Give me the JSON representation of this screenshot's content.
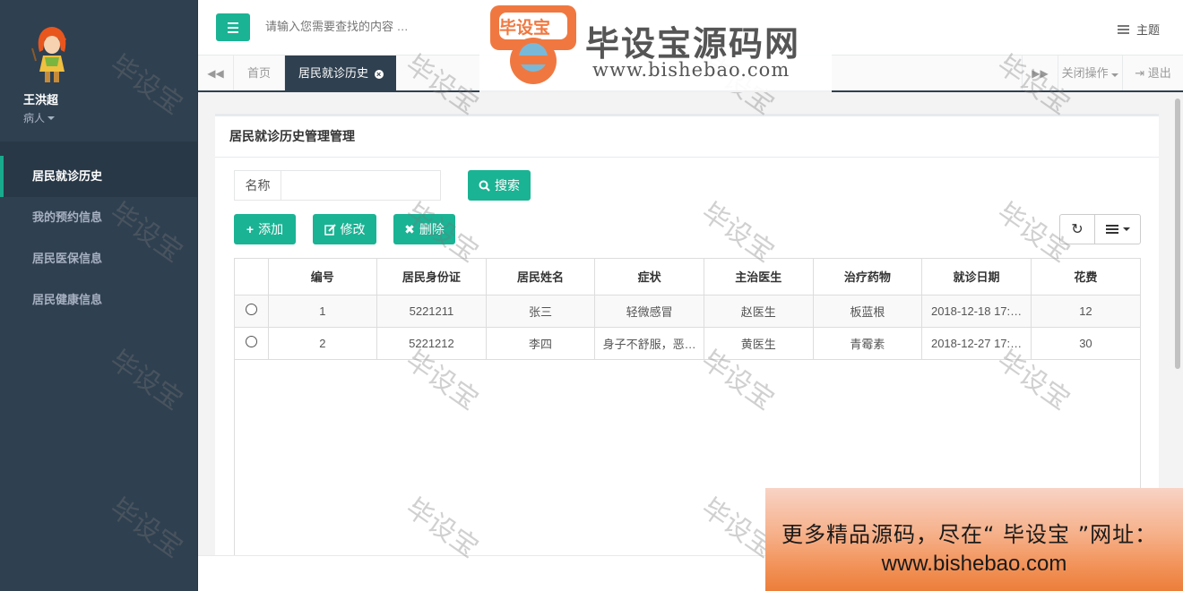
{
  "sidebar": {
    "user_name": "王洪超",
    "user_role": "病人",
    "items": [
      {
        "label": "居民就诊历史"
      },
      {
        "label": "我的预约信息"
      },
      {
        "label": "居民医保信息"
      },
      {
        "label": "居民健康信息"
      }
    ]
  },
  "topbar": {
    "search_placeholder": "请输入您需要查找的内容 …",
    "theme_label": "主题"
  },
  "tabs": {
    "home": "首页",
    "active": "居民就诊历史",
    "close_ops": "关闭操作",
    "logout": "退出"
  },
  "panel": {
    "title": "居民就诊历史管理管理",
    "search_label": "名称",
    "search_value": "",
    "search_button": "搜索",
    "add_button": "添加",
    "edit_button": "修改",
    "delete_button": "删除"
  },
  "table": {
    "columns": [
      "编号",
      "居民身份证",
      "居民姓名",
      "症状",
      "主治医生",
      "治疗药物",
      "就诊日期",
      "花费"
    ],
    "rows": [
      {
        "id": "1",
        "idcard": "5221211",
        "name": "张三",
        "symptom": "轻微感冒",
        "doctor": "赵医生",
        "medicine": "板蓝根",
        "date": "2018-12-18 17:…",
        "cost": "12"
      },
      {
        "id": "2",
        "idcard": "5221212",
        "name": "李四",
        "symptom": "身子不舒服，恶…",
        "doctor": "黄医生",
        "medicine": "青霉素",
        "date": "2018-12-27 17:…",
        "cost": "30"
      }
    ]
  },
  "branding": {
    "logo_badge": "毕设宝",
    "logo_title": "毕设宝源码网",
    "logo_url": "www.bishebao.com",
    "watermark": "毕设宝",
    "promo_line1": "更多精品源码，尽在“ 毕设宝 ”网址：",
    "promo_line2": "www.bishebao.com"
  },
  "colors": {
    "sidebar_bg": "#2f4050",
    "accent": "#1ab394",
    "page_bg": "#f3f3f4"
  }
}
